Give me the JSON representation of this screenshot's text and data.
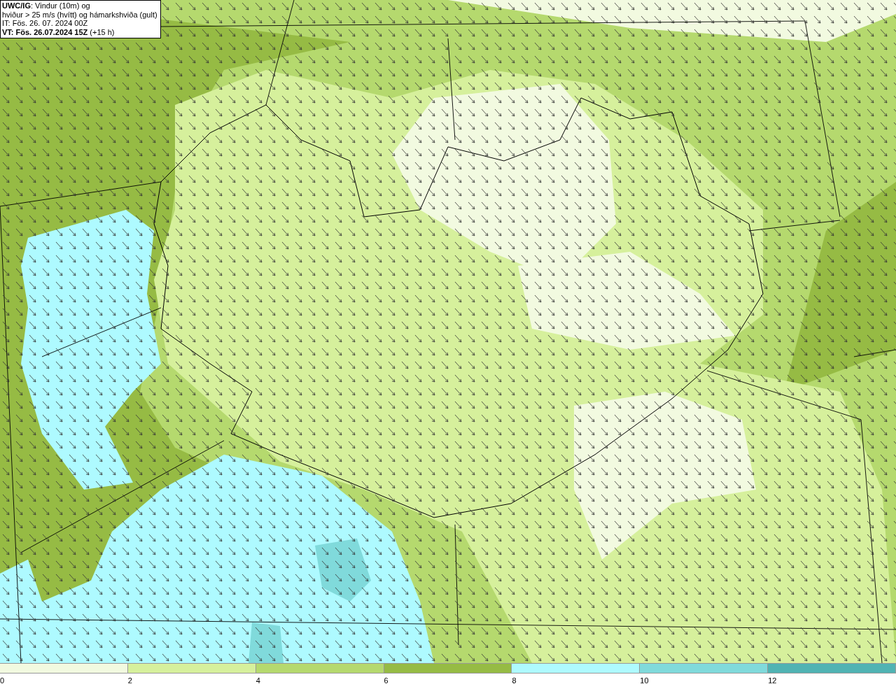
{
  "legend": {
    "lines": [
      "**UWC/IG**: Vindur (10m) og",
      "hviður > 25 m/s (hvítt) og hámarkshviða (gult)",
      "IT: Fös. 26. 07. 2024 00Z",
      "**VT: Fös. 26.07.2024 15Z** (+15 h)"
    ]
  },
  "colorbar": {
    "bins": [
      {
        "color": "#f2fae0"
      },
      {
        "color": "#d6f09c"
      },
      {
        "color": "#b5d96e"
      },
      {
        "color": "#96bb44"
      },
      {
        "color": "#aefaff"
      },
      {
        "color": "#80dadb"
      },
      {
        "color": "#50b3b3"
      }
    ],
    "ticks": [
      "0",
      "2",
      "4",
      "6",
      "8",
      "10",
      "12"
    ]
  }
}
